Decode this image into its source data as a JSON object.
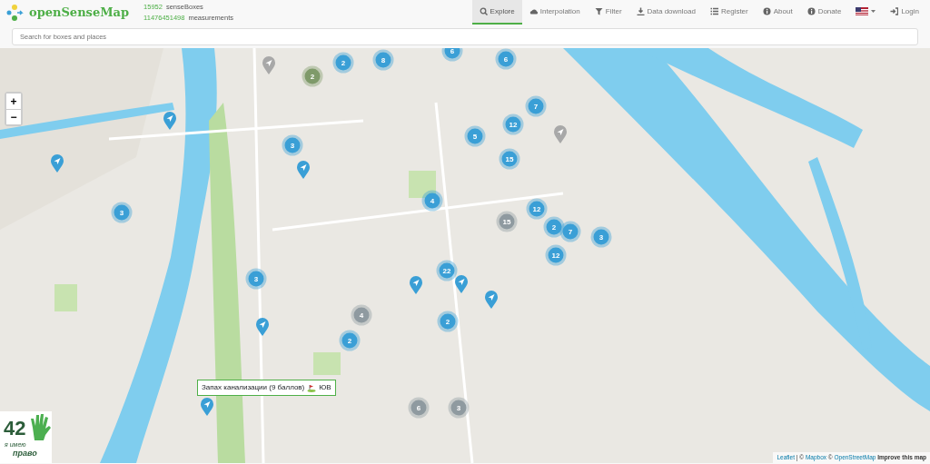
{
  "brand": {
    "name": "openSenseMap"
  },
  "stats": [
    {
      "count": "15952",
      "unit": "senseBoxes"
    },
    {
      "count": "11476451498",
      "unit": "measurements"
    }
  ],
  "nav": [
    {
      "kind": "link",
      "label": "Explore",
      "selected": true
    },
    {
      "kind": "link",
      "label": "Interpolation",
      "selected": false
    },
    {
      "kind": "link",
      "label": "Filter",
      "selected": false
    },
    {
      "kind": "link",
      "label": "Data download",
      "selected": false
    },
    {
      "kind": "link",
      "label": "Register",
      "selected": false
    },
    {
      "kind": "link",
      "label": "About",
      "selected": false
    },
    {
      "kind": "link",
      "label": "Donate",
      "selected": false
    },
    {
      "kind": "flag",
      "selected": false
    },
    {
      "kind": "link",
      "label": "Login",
      "selected": false
    }
  ],
  "search": {
    "placeholder": "Search for boxes and places"
  },
  "map": {
    "zoom_controls": [
      "+",
      "−"
    ],
    "markers": [
      {
        "kind": "cluster",
        "count": "2",
        "color": "#3a9fd6"
      },
      {
        "kind": "cluster",
        "count": "8",
        "color": "#3a9fd6"
      },
      {
        "kind": "cluster",
        "count": "6",
        "color": "#3a9fd6"
      },
      {
        "kind": "cluster",
        "count": "6",
        "color": "#3a9fd6"
      },
      {
        "kind": "cluster",
        "count": "2",
        "color": "#7f9a6a"
      },
      {
        "kind": "cluster",
        "count": "7",
        "color": "#3a9fd6"
      },
      {
        "kind": "cluster",
        "count": "12",
        "color": "#3a9fd6"
      },
      {
        "kind": "cluster",
        "count": "5",
        "color": "#3a9fd6"
      },
      {
        "kind": "cluster",
        "count": "15",
        "color": "#3a9fd6"
      },
      {
        "kind": "cluster",
        "count": "3",
        "color": "#3a9fd6"
      },
      {
        "kind": "cluster",
        "count": "4",
        "color": "#3a9fd6"
      },
      {
        "kind": "cluster",
        "count": "3",
        "color": "#3a9fd6"
      },
      {
        "kind": "cluster",
        "count": "12",
        "color": "#3a9fd6"
      },
      {
        "kind": "cluster",
        "count": "15",
        "color": "#8f9aa0"
      },
      {
        "kind": "cluster",
        "count": "2",
        "color": "#3a9fd6"
      },
      {
        "kind": "cluster",
        "count": "7",
        "color": "#3a9fd6"
      },
      {
        "kind": "cluster",
        "count": "3",
        "color": "#3a9fd6"
      },
      {
        "kind": "cluster",
        "count": "12",
        "color": "#3a9fd6"
      },
      {
        "kind": "cluster",
        "count": "22",
        "color": "#3a9fd6"
      },
      {
        "kind": "cluster",
        "count": "3",
        "color": "#3a9fd6"
      },
      {
        "kind": "cluster",
        "count": "4",
        "color": "#8f9aa0"
      },
      {
        "kind": "cluster",
        "count": "2",
        "color": "#3a9fd6"
      },
      {
        "kind": "cluster",
        "count": "2",
        "color": "#3a9fd6"
      },
      {
        "kind": "cluster",
        "count": "6",
        "color": "#8f9aa0"
      },
      {
        "kind": "cluster",
        "count": "3",
        "color": "#8f9aa0"
      },
      {
        "kind": "pin",
        "color": "#3a9fd6"
      },
      {
        "kind": "pin",
        "color": "#3a9fd6"
      },
      {
        "kind": "pin",
        "color": "#3a9fd6"
      },
      {
        "kind": "pin",
        "color": "#3a9fd6"
      },
      {
        "kind": "pin",
        "color": "#3a9fd6"
      },
      {
        "kind": "pin",
        "color": "#3a9fd6"
      },
      {
        "kind": "pin",
        "color": "#3a9fd6"
      },
      {
        "kind": "pin",
        "color": "#3a9fd6"
      },
      {
        "kind": "pin",
        "color": "#a8a8a8"
      },
      {
        "kind": "pin",
        "color": "#a8a8a8"
      }
    ],
    "tooltip": {
      "text": "Запах канализации (9 баллов)",
      "suffix": "ЮВ"
    },
    "logo": {
      "number": "42",
      "line_1": "я имею",
      "line_2": "право"
    },
    "attribution": {
      "parts": [
        {
          "kind": "link",
          "text": "Leaflet"
        },
        {
          "kind": "text",
          "text": "| ©"
        },
        {
          "kind": "link",
          "text": "Mapbox"
        },
        {
          "kind": "text",
          "text": "©"
        },
        {
          "kind": "link",
          "text": "OpenStreetMap"
        },
        {
          "kind": "bold_link",
          "text": "Improve this map"
        }
      ]
    }
  }
}
